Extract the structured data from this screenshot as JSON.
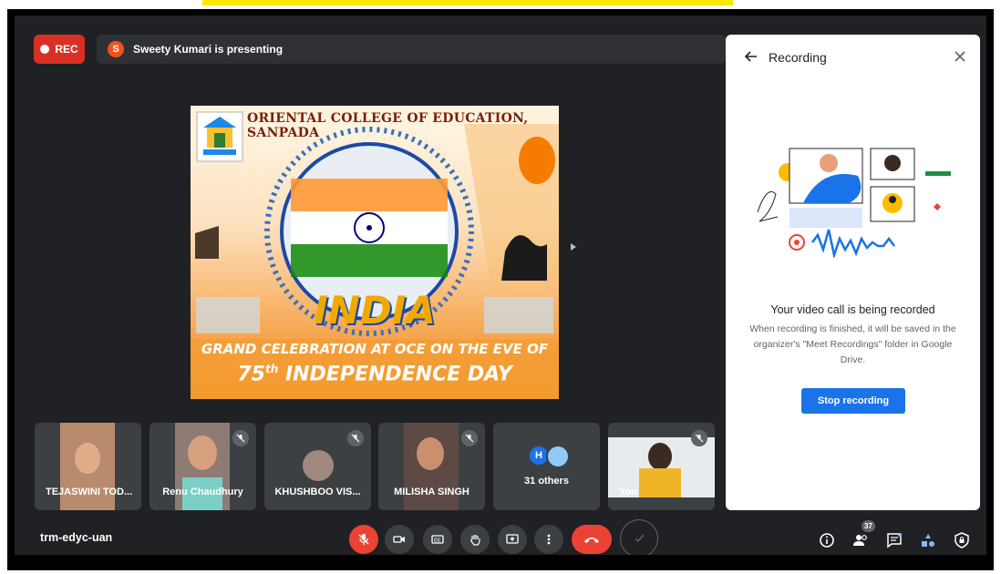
{
  "meeting": {
    "rec_label": "REC",
    "presenter_initial": "S",
    "presenting_text": "Sweety Kumari is presenting",
    "code": "trm-edyc-uan"
  },
  "slide": {
    "college": "ORIENTAL COLLEGE OF EDUCATION, SANPADA",
    "headline": "INDIA",
    "line1": "GRAND CELEBRATION AT OCE ON THE EVE OF",
    "line2_number": "75",
    "line2_suffix": "th",
    "line2_text": "INDEPENDENCE DAY"
  },
  "tiles": [
    {
      "name": "TEJASWINI TOD...",
      "muted": false
    },
    {
      "name": "Renu Chaudhury",
      "muted": true
    },
    {
      "name": "KHUSHBOO VIS...",
      "muted": true
    },
    {
      "name": "MILISHA SINGH",
      "muted": true
    },
    {
      "name": "31 others",
      "avatar_initial": "H",
      "muted": false
    },
    {
      "name": "You",
      "muted": true
    }
  ],
  "panel": {
    "title": "Recording",
    "heading": "Your video call is being recorded",
    "description": "When recording is finished, it will be saved in the organizer's \"Meet Recordings\" folder in Google Drive.",
    "stop_label": "Stop recording"
  },
  "toolbar": {
    "participants_count": "37"
  },
  "colors": {
    "background": "#202124",
    "tile": "#3c4043",
    "rec_red": "#d93025",
    "end_call": "#ea4335",
    "primary_blue": "#1a73e8",
    "banner_yellow": "#ffe600"
  }
}
